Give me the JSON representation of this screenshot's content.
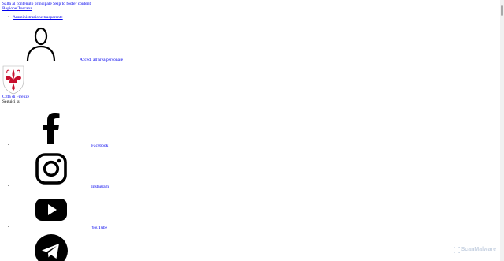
{
  "skip_links": {
    "main_content": "Salta al contenuto principale",
    "footer_content": "Skip to footer content"
  },
  "header": {
    "region_link": "Regione Toscana",
    "utility_items": [
      "Amministrazione trasparente"
    ],
    "login_label": "Accedi all'area personale",
    "login_icon": "user-icon",
    "city_name": "Città di Firenze",
    "crest_icon": "florence-lily-crest"
  },
  "social": {
    "follow_label": "Seguici su",
    "items": [
      {
        "name": "Facebook",
        "icon": "facebook-icon"
      },
      {
        "name": "Instagram",
        "icon": "instagram-icon"
      },
      {
        "name": "YouTube",
        "icon": "youtube-icon"
      },
      {
        "name": "Telegram",
        "icon": "telegram-icon"
      }
    ]
  },
  "watermark": {
    "text": "ScanMalware"
  },
  "colors": {
    "link": "#0000ee",
    "crest_red": "#c8102e",
    "watermark": "#c7d2e2"
  }
}
